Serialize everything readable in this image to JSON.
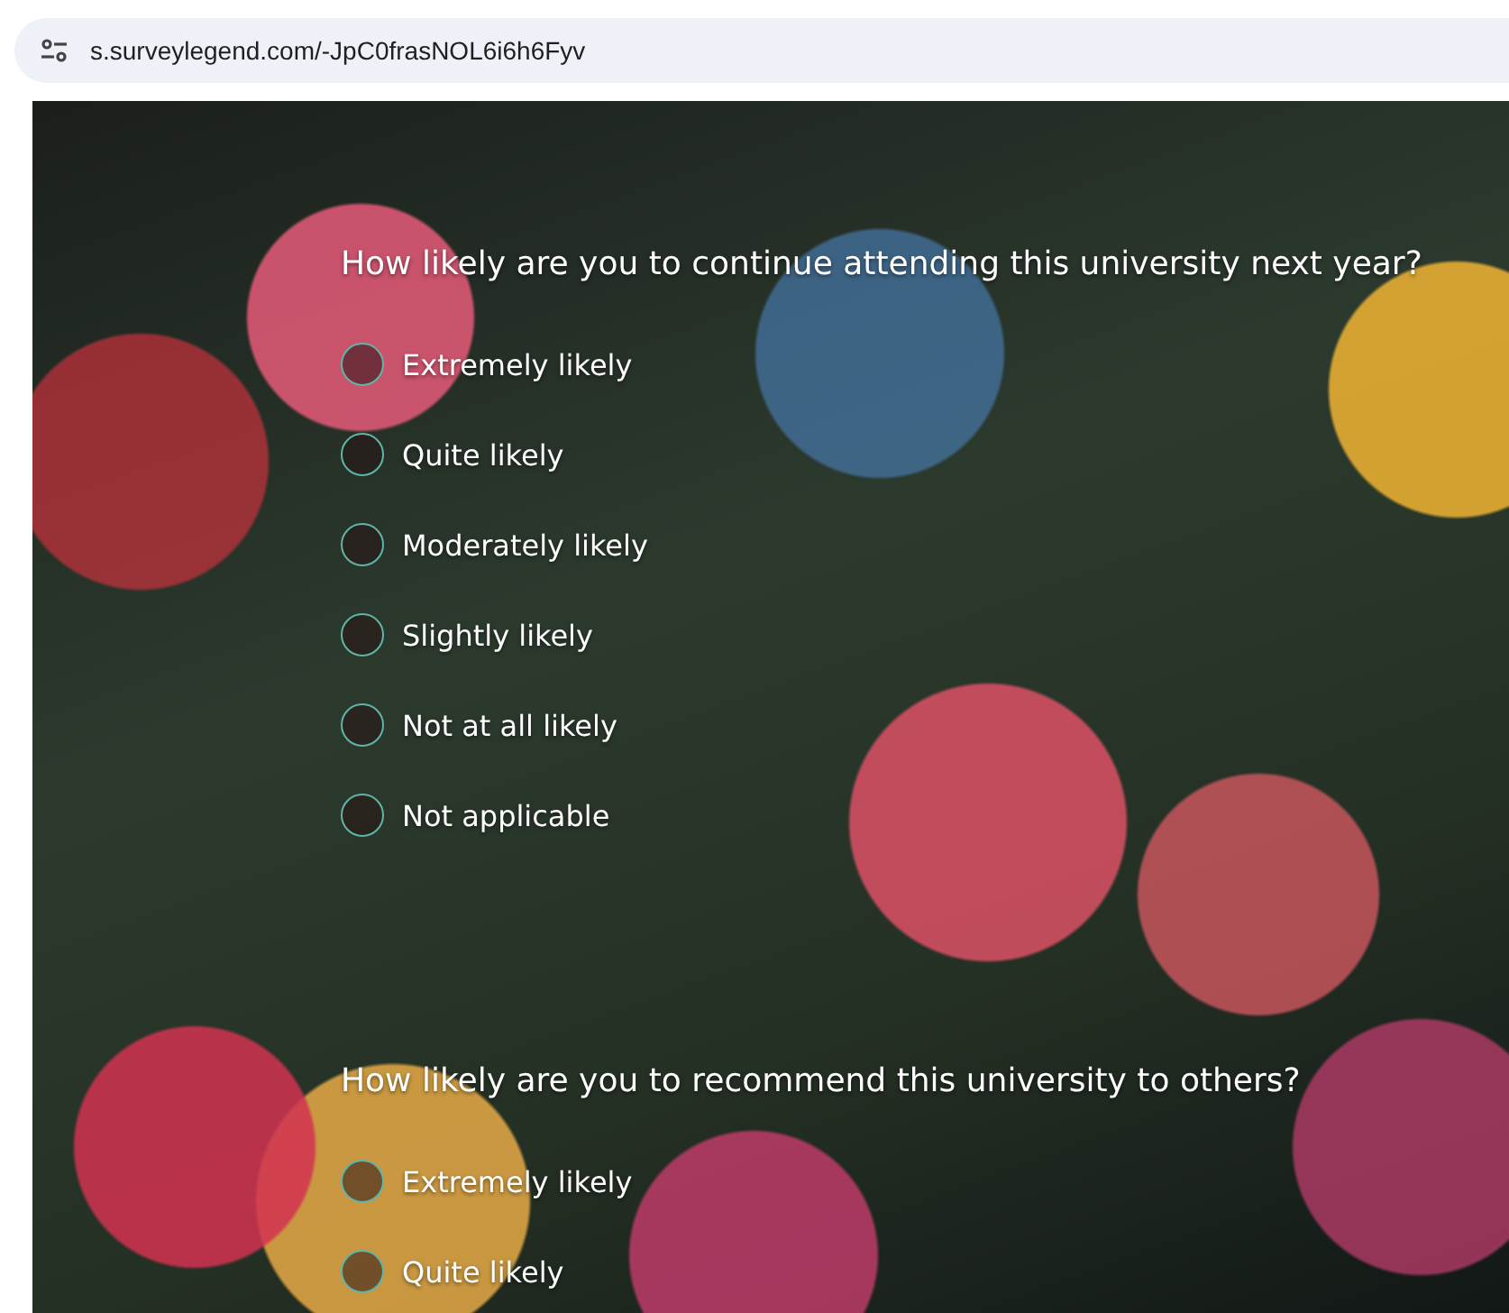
{
  "address_bar": {
    "url": "s.surveylegend.com/-JpC0frasNOL6i6h6Fyv"
  },
  "questions": [
    {
      "text": "How likely are you to continue attending this university next year?",
      "options": [
        {
          "label": "Extremely likely",
          "selected": false
        },
        {
          "label": "Quite likely",
          "selected": false
        },
        {
          "label": "Moderately likely",
          "selected": false
        },
        {
          "label": "Slightly likely",
          "selected": false
        },
        {
          "label": "Not at all likely",
          "selected": false
        },
        {
          "label": "Not applicable",
          "selected": false
        }
      ]
    },
    {
      "text": "How likely are you to recommend this university to others?",
      "options": [
        {
          "label": "Extremely likely",
          "selected": false
        },
        {
          "label": "Quite likely",
          "selected": false
        }
      ]
    }
  ]
}
